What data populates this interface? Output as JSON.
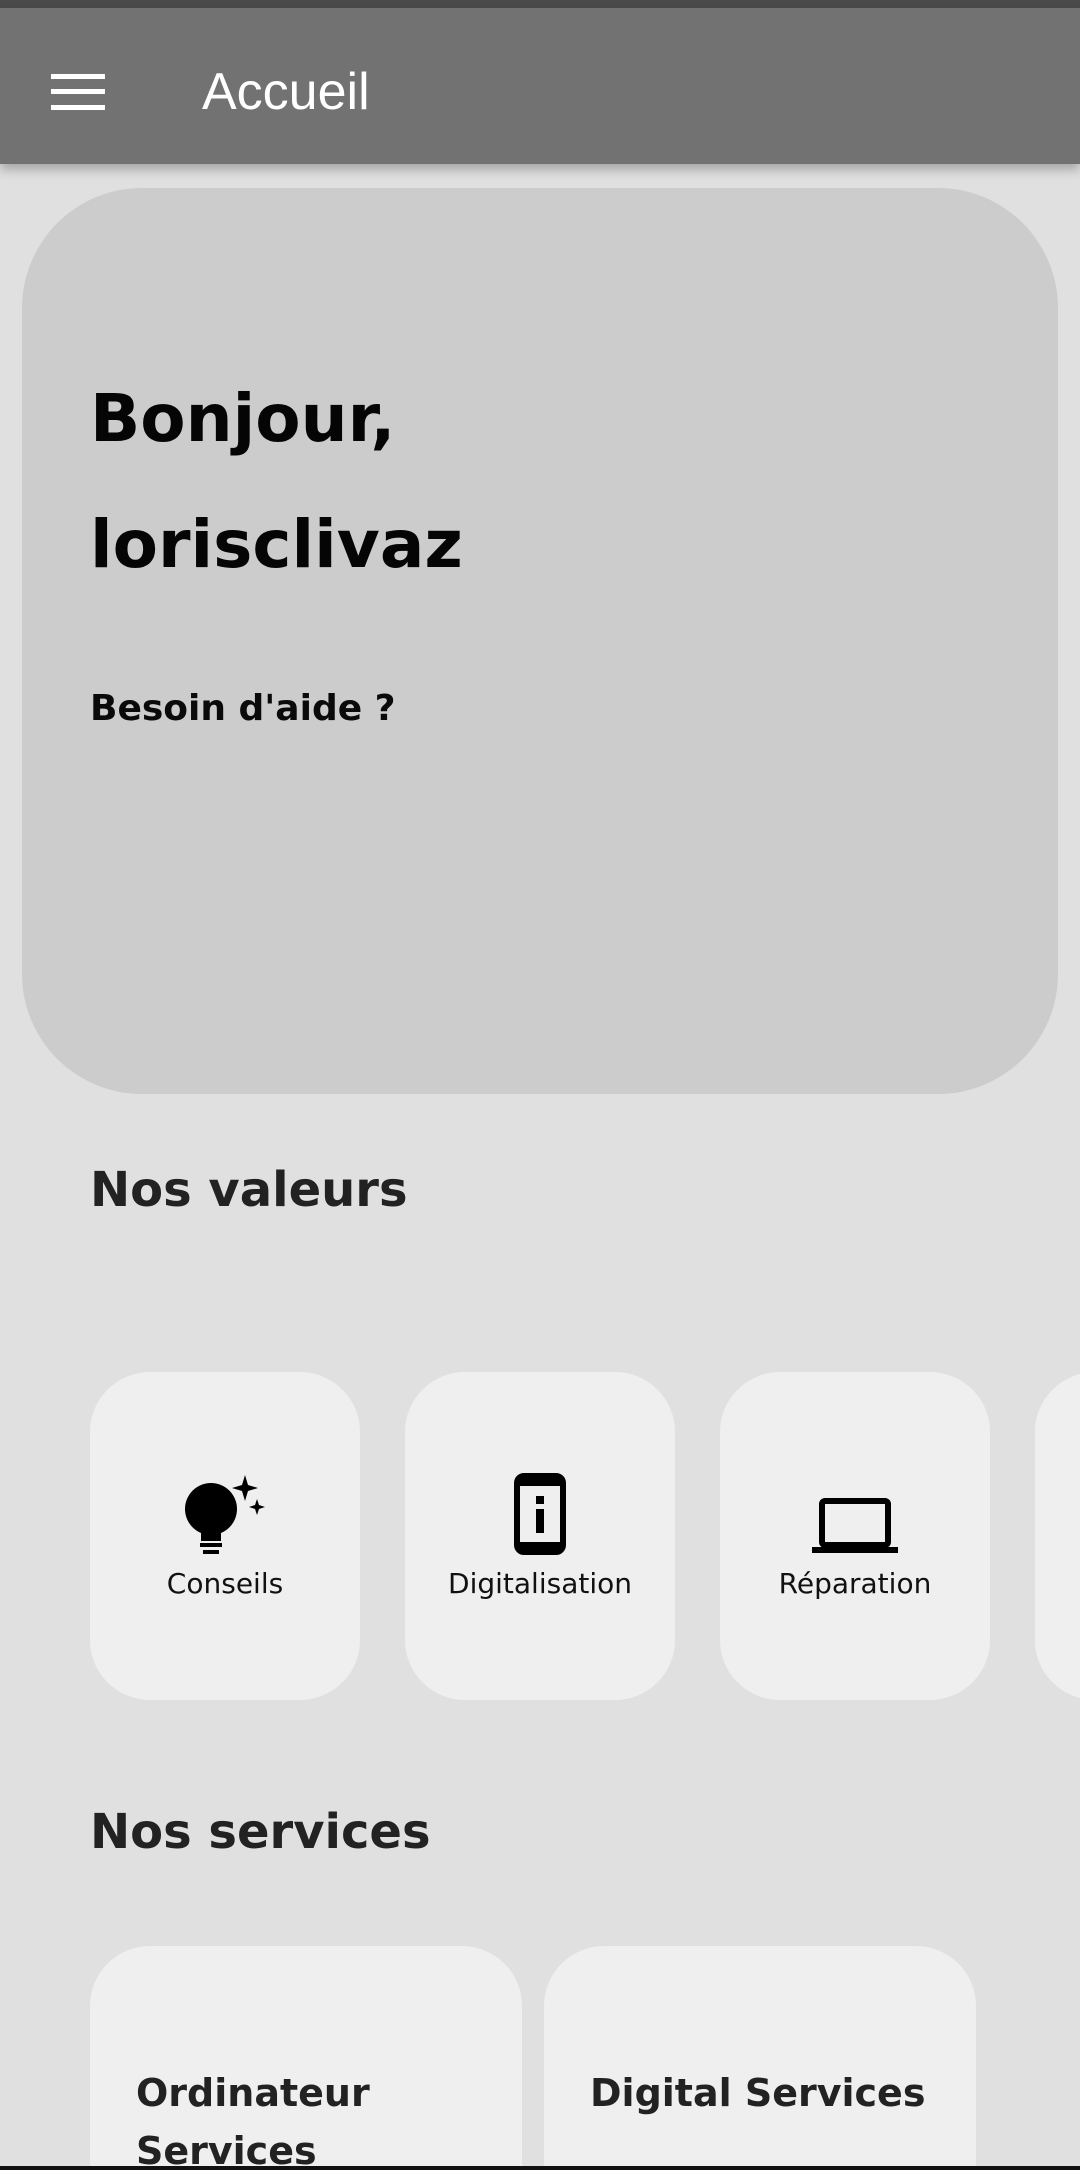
{
  "app_bar": {
    "title": "Accueil",
    "menu_icon": "hamburger-menu-icon"
  },
  "hero": {
    "greeting_line1": "Bonjour,",
    "greeting_line2": "lorisclivaz",
    "help_label": "Besoin d'aide ?"
  },
  "values": {
    "title": "Nos valeurs",
    "items": [
      {
        "label": "Conseils",
        "icon": "lightbulb-sparkle-icon"
      },
      {
        "label": "Digitalisation",
        "icon": "smartphone-info-icon"
      },
      {
        "label": "Réparation",
        "icon": "laptop-icon"
      }
    ]
  },
  "services": {
    "title": "Nos services",
    "items": [
      {
        "label": "Ordinateur Services"
      },
      {
        "label": "Digital Services"
      }
    ]
  },
  "colors": {
    "background": "#e0e0e0",
    "app_bar": "#727272",
    "hero_card": "#cccccc",
    "card": "#efefef"
  }
}
